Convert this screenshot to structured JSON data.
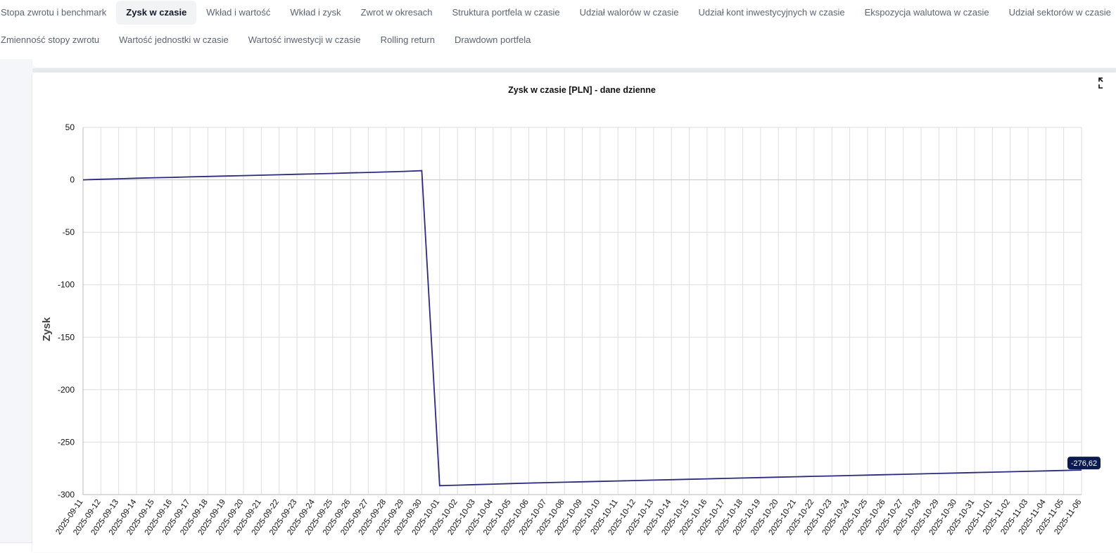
{
  "tabs": {
    "row1": [
      {
        "label": "Stopa zwrotu i benchmark",
        "active": false
      },
      {
        "label": "Zysk w czasie",
        "active": true
      },
      {
        "label": "Wkład i wartość",
        "active": false
      },
      {
        "label": "Wkład i zysk",
        "active": false
      },
      {
        "label": "Zwrot w okresach",
        "active": false
      },
      {
        "label": "Struktura portfela w czasie",
        "active": false
      },
      {
        "label": "Udział walorów w czasie",
        "active": false
      },
      {
        "label": "Udział kont inwestycyjnych w czasie",
        "active": false
      },
      {
        "label": "Ekspozycja walutowa w czasie",
        "active": false
      },
      {
        "label": "Udział sektorów w czasie",
        "active": false
      }
    ],
    "row2": [
      {
        "label": "Zmienność stopy zwrotu",
        "active": false
      },
      {
        "label": "Wartość jednostki w czasie",
        "active": false
      },
      {
        "label": "Wartość inwestycji w czasie",
        "active": false
      },
      {
        "label": "Rolling return",
        "active": false
      },
      {
        "label": "Drawdown portfela",
        "active": false
      }
    ]
  },
  "expand_icon": "expand-icon",
  "chart_data": {
    "type": "line",
    "title": "Zysk w czasie [PLN] - dane dzienne",
    "xlabel": "",
    "ylabel": "Zysk",
    "ylim": [
      -300,
      50
    ],
    "yticks": [
      50,
      0,
      -50,
      -100,
      -150,
      -200,
      -250,
      -300
    ],
    "grid": true,
    "line_color": "#2b2a7c",
    "x": [
      "2025-09-11",
      "2025-09-12",
      "2025-09-13",
      "2025-09-14",
      "2025-09-15",
      "2025-09-16",
      "2025-09-17",
      "2025-09-18",
      "2025-09-19",
      "2025-09-20",
      "2025-09-21",
      "2025-09-22",
      "2025-09-23",
      "2025-09-24",
      "2025-09-25",
      "2025-09-26",
      "2025-09-27",
      "2025-09-28",
      "2025-09-29",
      "2025-09-30",
      "2025-10-01",
      "2025-10-02",
      "2025-10-03",
      "2025-10-04",
      "2025-10-05",
      "2025-10-06",
      "2025-10-07",
      "2025-10-08",
      "2025-10-09",
      "2025-10-10",
      "2025-10-11",
      "2025-10-12",
      "2025-10-13",
      "2025-10-14",
      "2025-10-15",
      "2025-10-16",
      "2025-10-17",
      "2025-10-18",
      "2025-10-19",
      "2025-10-20",
      "2025-10-21",
      "2025-10-22",
      "2025-10-23",
      "2025-10-24",
      "2025-10-25",
      "2025-10-26",
      "2025-10-27",
      "2025-10-28",
      "2025-10-29",
      "2025-10-30",
      "2025-10-31",
      "2025-11-01",
      "2025-11-02",
      "2025-11-03",
      "2025-11-04",
      "2025-11-05",
      "2025-11-06"
    ],
    "series": [
      {
        "values": [
          0,
          0.5,
          1,
          1.5,
          2,
          2.3,
          2.8,
          3.2,
          3.6,
          4,
          4.4,
          4.8,
          5.3,
          5.7,
          6.1,
          6.6,
          7,
          7.5,
          8,
          8.7,
          -291.5,
          -291,
          -290.5,
          -290,
          -289.5,
          -289,
          -288.6,
          -288.2,
          -287.8,
          -287.4,
          -287,
          -286.6,
          -286.2,
          -285.8,
          -285.4,
          -285,
          -284.6,
          -284.2,
          -283.8,
          -283.4,
          -283,
          -282.6,
          -282.2,
          -281.8,
          -281.4,
          -281,
          -280.6,
          -280.2,
          -279.8,
          -279.4,
          -279,
          -278.6,
          -278.2,
          -277.8,
          -277.4,
          -277,
          -276.62
        ]
      }
    ],
    "last_value_label": "-276,62"
  }
}
